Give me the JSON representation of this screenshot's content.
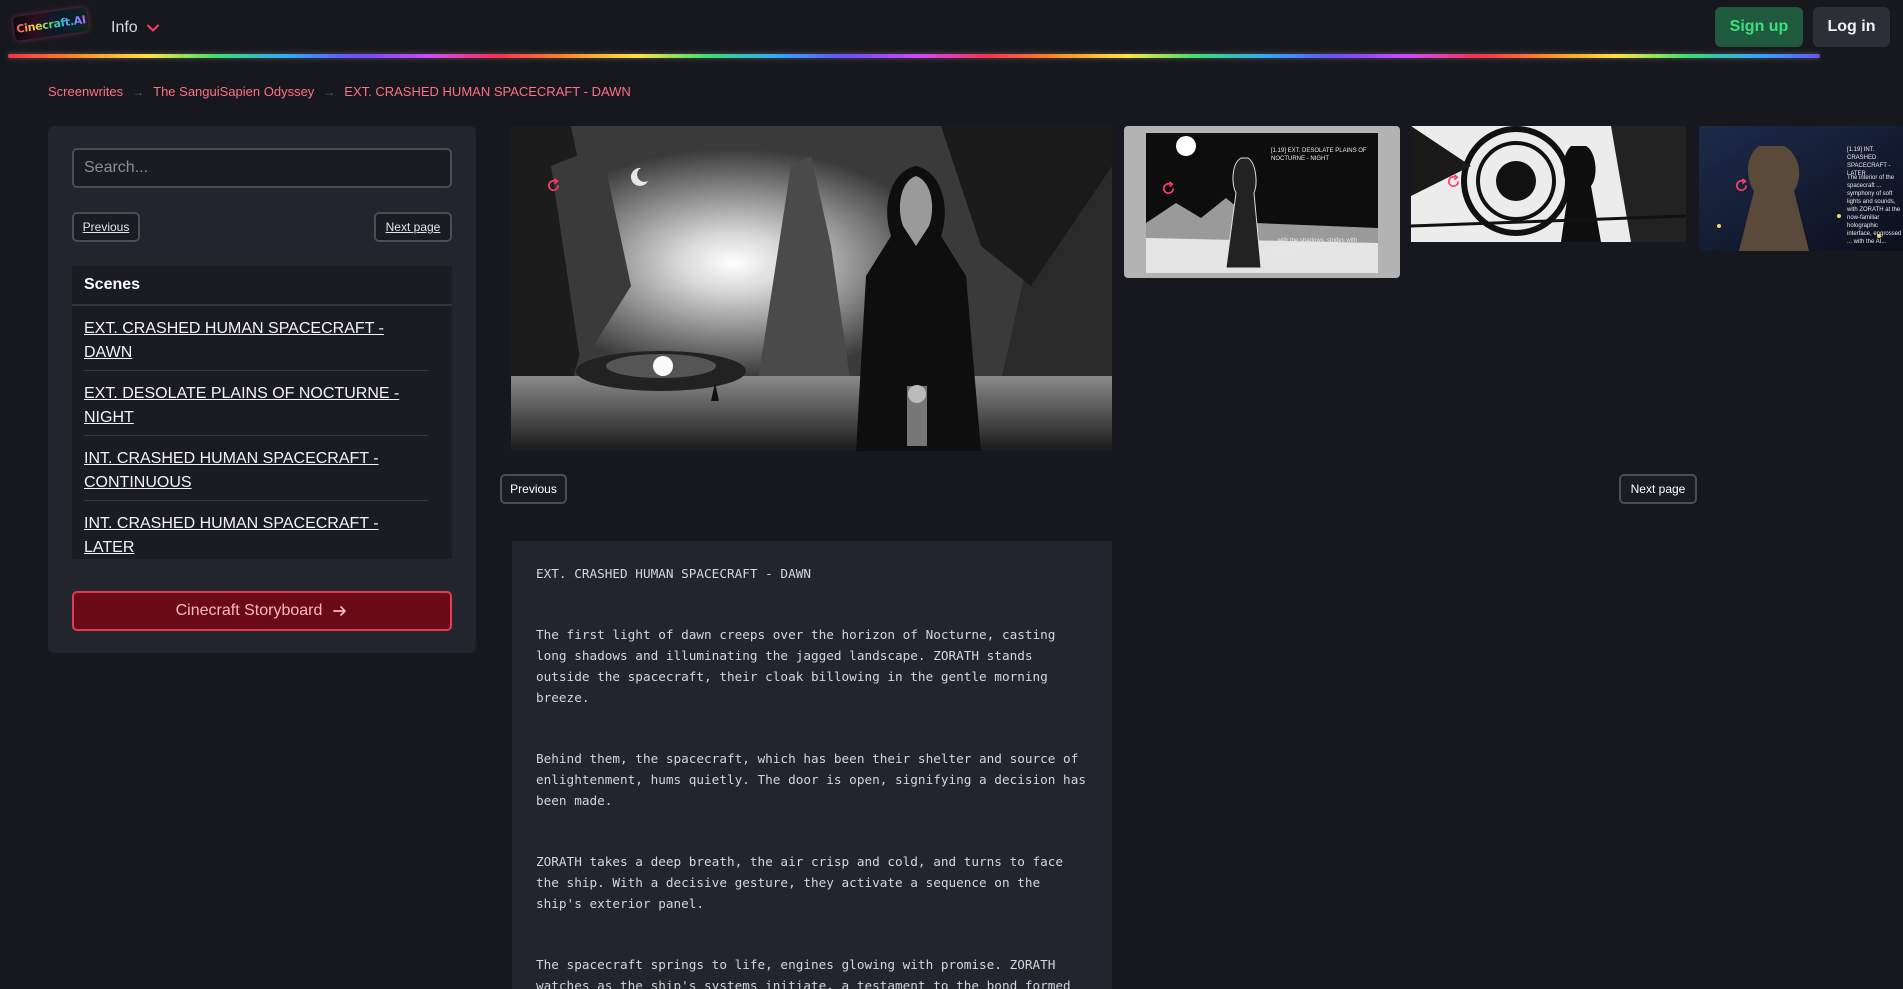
{
  "header": {
    "logo_text": "Cinecraft.AI",
    "info_label": "Info",
    "signup_label": "Sign up",
    "login_label": "Log in"
  },
  "breadcrumb": {
    "items": [
      "Screenwrites",
      "The SanguiSapien Odyssey",
      "EXT. CRASHED HUMAN SPACECRAFT - DAWN"
    ],
    "separator": "→"
  },
  "sidebar": {
    "search_placeholder": "Search...",
    "previous_label": "Previous",
    "next_label": "Next page",
    "scenes_title": "Scenes",
    "scenes": [
      "EXT. CRASHED HUMAN SPACECRAFT - DAWN",
      "EXT. DESOLATE PLAINS OF NOCTURNE - NIGHT",
      "INT. CRASHED HUMAN SPACECRAFT - CONTINUOUS",
      "INT. CRASHED HUMAN SPACECRAFT - LATER"
    ],
    "storyboard_label": "Cinecraft Storyboard"
  },
  "thumbnails": {
    "thumb1_caption": "[1.19] EXT. DESOLATE PLAINS OF NOCTURNE - NIGHT",
    "thumb1_body": "... with the shadows, strides with purpose...",
    "thumb3_caption": "[1.19] INT. CRASHED SPACECRAFT - LATER",
    "thumb3_body": "The interior of the spacecraft ... symphony of soft lights and sounds, with ZORATH at the now-familiar holographic interface, engrossed ... with the AI..."
  },
  "pagination": {
    "previous_label": "Previous",
    "next_label": "Next page"
  },
  "script": {
    "heading": "EXT. CRASHED HUMAN SPACECRAFT - DAWN",
    "paragraphs": [
      "The first light of dawn creeps over the horizon of Nocturne, casting long shadows and illuminating the jagged landscape. ZORATH stands outside the spacecraft, their cloak billowing in the gentle morning breeze.",
      "Behind them, the spacecraft, which has been their shelter and source of enlightenment, hums quietly. The door is open, signifying a decision has been made.",
      "ZORATH takes a deep breath, the air crisp and cold, and turns to face the ship. With a decisive gesture, they activate a sequence on the ship's exterior panel.",
      "The spacecraft springs to life, engines glowing with promise. ZORATH watches as the ship's systems initiate, a testament to the bond formed"
    ]
  },
  "colors": {
    "background": "#17181d",
    "panel": "#23252d",
    "accent_pink": "#ff6e8a",
    "signup_green": "#3ee07a",
    "storyboard_red": "#6b0a17"
  },
  "icons": [
    "chevron-down-icon",
    "arrow-right-icon",
    "refresh-icon"
  ]
}
